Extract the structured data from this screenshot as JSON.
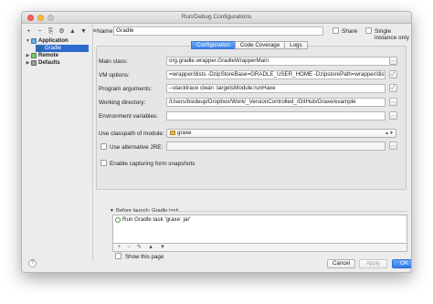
{
  "window": {
    "title": "Run/Debug Configurations"
  },
  "left_toolbar": {
    "buttons": [
      "+",
      "−",
      "⎘",
      "⚙",
      "▲",
      "▼",
      "≡"
    ]
  },
  "tree": {
    "application": "Application",
    "gradle": "Gradle",
    "remote": "Remote",
    "defaults": "Defaults"
  },
  "header": {
    "name_label": "Name:",
    "name_value": "Gradle",
    "share_label": "Share",
    "single_instance_label": "Single instance only",
    "share_checked": false,
    "single_instance_checked": false
  },
  "tabs": [
    "Configuration",
    "Code Coverage",
    "Logs"
  ],
  "form": {
    "main_class_label": "Main class:",
    "main_class_value": "org.gradle.wrapper.GradleWrapperMain",
    "vm_options_label": "VM options:",
    "vm_options_value": "=wrapper/dists -DzipStoreBase=GRADLE_USER_HOME -DzipstorePath=wrapper/dists",
    "program_args_label": "Program arguments:",
    "program_args_value": "--stacktrace clean :targetsModule:runHaxe",
    "working_dir_label": "Working directory:",
    "working_dir_value": "/Users/bsideup/Dropbox/Work/_VersionControlled_/GitHub/Graxe/example",
    "env_vars_label": "Environment variables:",
    "env_vars_value": "",
    "classpath_label": "Use classpath of module:",
    "classpath_value": "graxe",
    "alt_jre_label": "Use alternative JRE:",
    "alt_jre_value": "",
    "snapshots_label": "Enable capturing form snapshots"
  },
  "before_launch": {
    "header": "Before launch: Gradle task",
    "tasks": [
      "Run Gradle task 'graxe: jar'"
    ],
    "toolbar": [
      "+",
      "−",
      "✎",
      "▲",
      "▼"
    ]
  },
  "footer": {
    "show_page_label": "Show this page",
    "help_label": "?",
    "cancel_label": "Cancel",
    "apply_label": "Apply",
    "ok_label": "OK"
  },
  "colors": {
    "accent": "#3b82ee",
    "selection": "#2f6ad0"
  }
}
